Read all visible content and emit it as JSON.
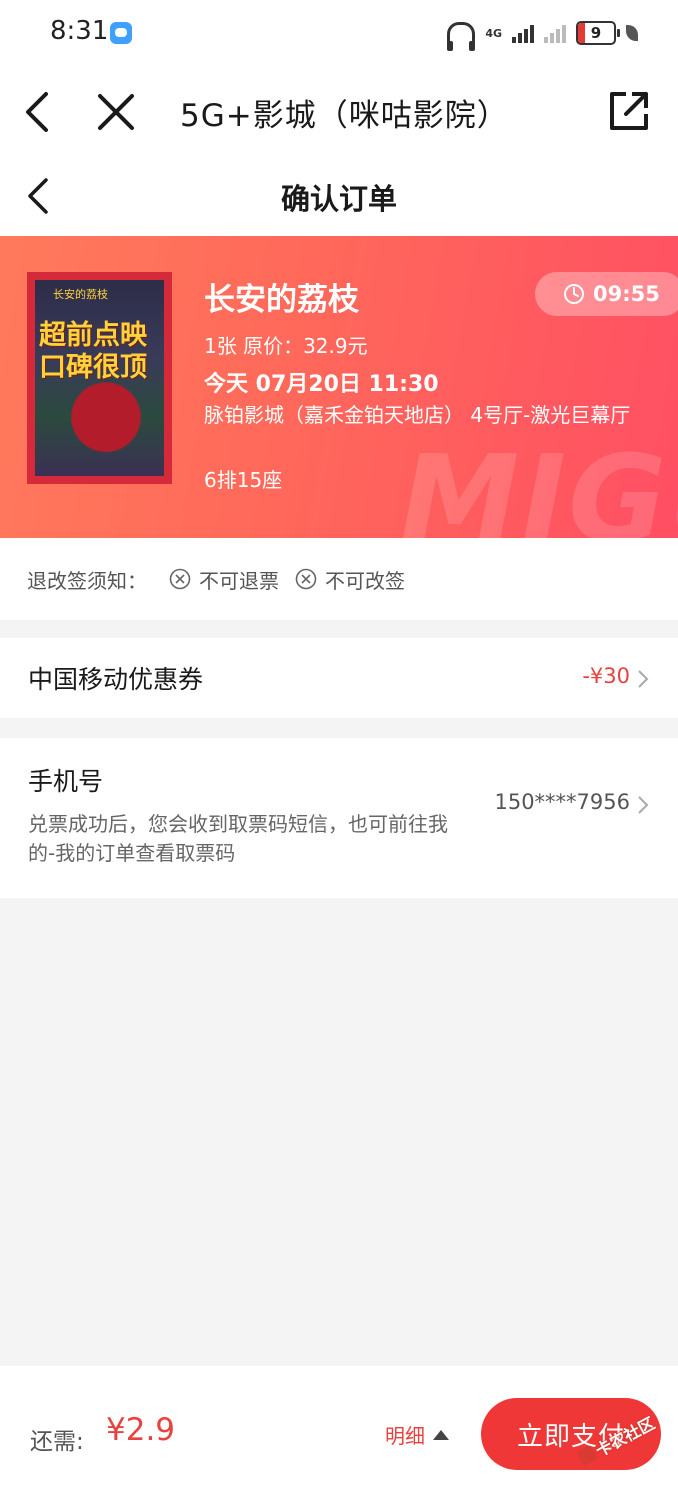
{
  "status_bar": {
    "time": "8:31",
    "network_label": "4G",
    "battery": "9"
  },
  "app_bar": {
    "title": "5G+影城（咪咕影院）"
  },
  "page": {
    "title": "确认订单"
  },
  "order": {
    "movie_title": "长安的荔枝",
    "poster_text": "超前点映口碑很顶",
    "poster_small": "长安的荔枝",
    "price_line": "1张  原价：32.9元",
    "date_line": "今天 07月20日 11:30",
    "cinema_line": "脉铂影城（嘉禾金铂天地店） 4号厅-激光巨幕厅",
    "seat_line": "6排15座",
    "countdown": "09:55",
    "watermark": "MIGU"
  },
  "policy": {
    "label": "退改签须知：",
    "no_refund": "不可退票",
    "no_change": "不可改签"
  },
  "coupon": {
    "label": "中国移动优惠券",
    "value": "-¥30"
  },
  "phone": {
    "label": "手机号",
    "note": "兑票成功后，您会收到取票码短信，也可前往我的-我的订单查看取票码",
    "value": "150****7956"
  },
  "bottom": {
    "need_label": "还需:",
    "need_amount": "¥2.9",
    "detail_label": "明细",
    "pay_label": "立即支付",
    "watermark": "卡农社区"
  },
  "colors": {
    "accent": "#ef3737",
    "hero_start": "#ff7a5c",
    "hero_end": "#ff4f63"
  }
}
